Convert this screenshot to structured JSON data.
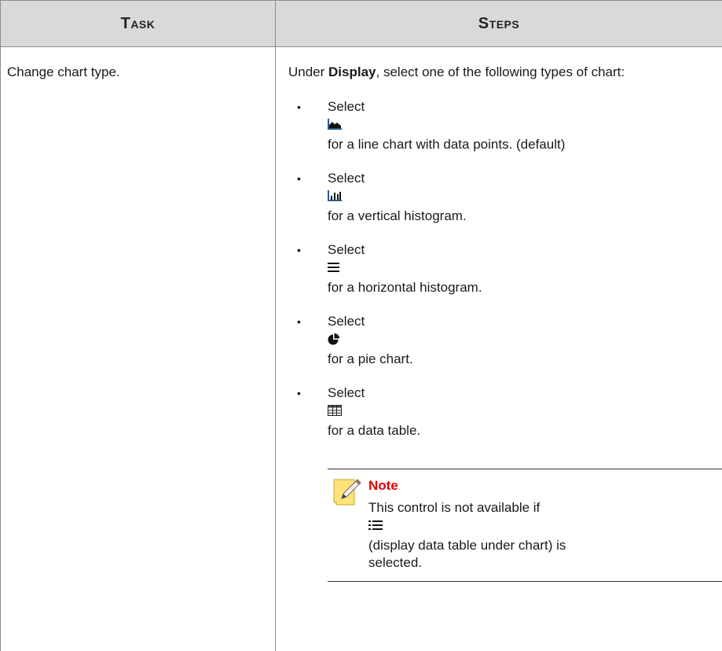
{
  "header": {
    "task": "Task",
    "steps": "Steps"
  },
  "row": {
    "task": "Change chart type.",
    "intro_prefix": "Under ",
    "intro_bold": "Display",
    "intro_suffix": ", select one of the following types of chart:",
    "items": [
      {
        "select": "Select",
        "icon": "area-chart-icon",
        "desc": "for a line chart with data points. (default)"
      },
      {
        "select": "Select",
        "icon": "vertical-histogram-icon",
        "desc": "for a vertical histogram."
      },
      {
        "select": "Select",
        "icon": "horizontal-histogram-icon",
        "desc": "for a horizontal histogram."
      },
      {
        "select": "Select",
        "icon": "pie-chart-icon",
        "desc": "for a pie chart."
      },
      {
        "select": "Select",
        "icon": "data-table-icon",
        "desc": "for a data table."
      }
    ],
    "bullet": "•"
  },
  "note": {
    "title": "Note",
    "line1": "This control is not available if",
    "icon": "data-table-under-chart-icon",
    "line2": "(display data table under chart) is selected."
  },
  "colors": {
    "header_bg": "#d9d9d9",
    "note_title": "#e00000",
    "border": "#8c8c8c"
  }
}
